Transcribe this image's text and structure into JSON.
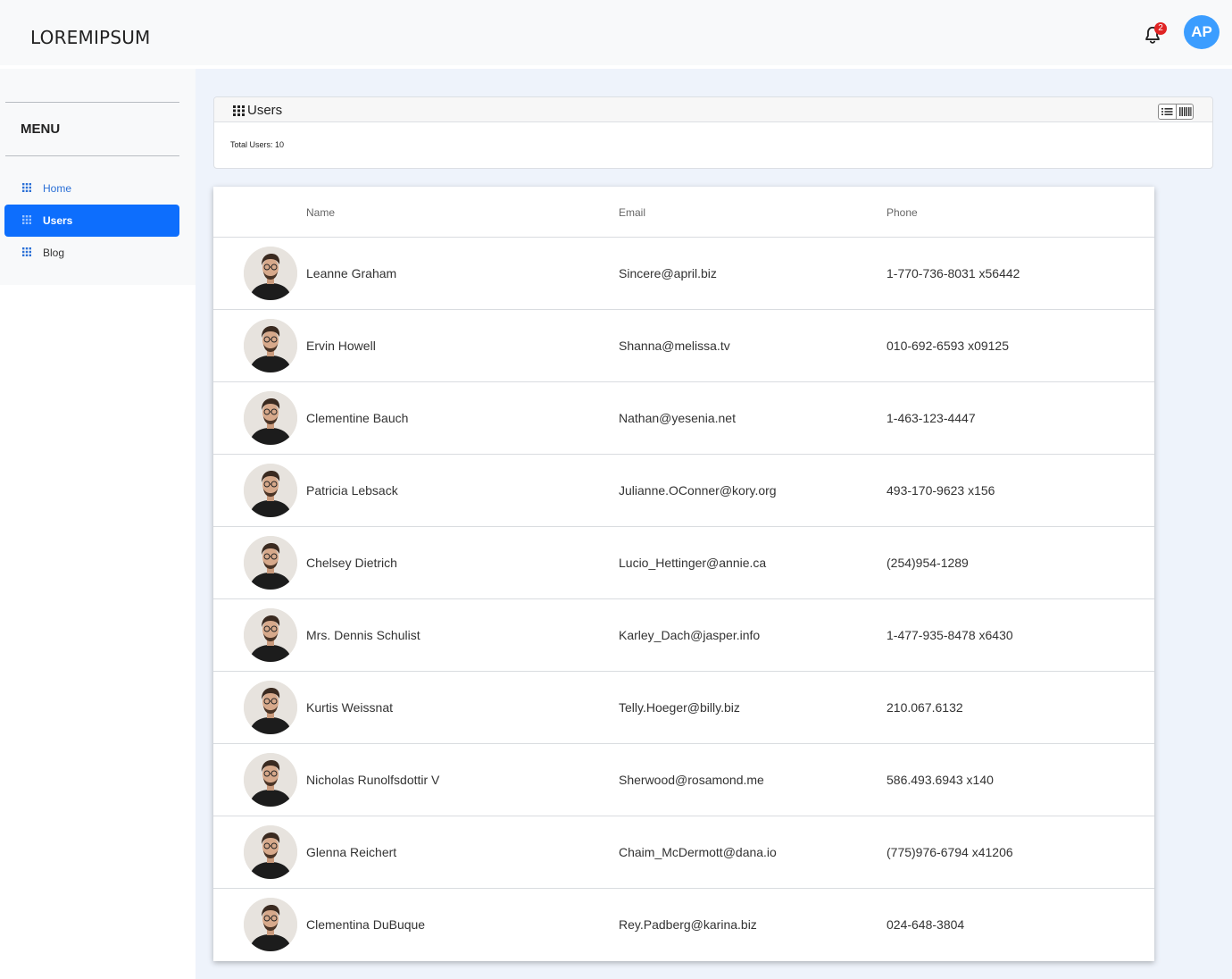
{
  "header": {
    "brand": "LOREMIPSUM",
    "notification_count": "2",
    "user_initials": "AP"
  },
  "sidebar": {
    "menu_title": "MENU",
    "items": [
      {
        "label": "Home",
        "icon": "grid-icon"
      },
      {
        "label": "Users",
        "icon": "grid-icon",
        "active": true
      },
      {
        "label": "Blog",
        "icon": "grid-icon"
      }
    ]
  },
  "users_card": {
    "title": "Users",
    "total_label": "Total Users: 10"
  },
  "table": {
    "columns": [
      "Name",
      "Email",
      "Phone"
    ],
    "rows": [
      {
        "name": "Leanne Graham",
        "email": "Sincere@april.biz",
        "phone": "1-770-736-8031 x56442"
      },
      {
        "name": "Ervin Howell",
        "email": "Shanna@melissa.tv",
        "phone": "010-692-6593 x09125"
      },
      {
        "name": "Clementine Bauch",
        "email": "Nathan@yesenia.net",
        "phone": "1-463-123-4447"
      },
      {
        "name": "Patricia Lebsack",
        "email": "Julianne.OConner@kory.org",
        "phone": "493-170-9623 x156"
      },
      {
        "name": "Chelsey Dietrich",
        "email": "Lucio_Hettinger@annie.ca",
        "phone": "(254)954-1289"
      },
      {
        "name": "Mrs. Dennis Schulist",
        "email": "Karley_Dach@jasper.info",
        "phone": "1-477-935-8478 x6430"
      },
      {
        "name": "Kurtis Weissnat",
        "email": "Telly.Hoeger@billy.biz",
        "phone": "210.067.6132"
      },
      {
        "name": "Nicholas Runolfsdottir V",
        "email": "Sherwood@rosamond.me",
        "phone": "586.493.6943 x140"
      },
      {
        "name": "Glenna Reichert",
        "email": "Chaim_McDermott@dana.io",
        "phone": "(775)976-6794 x41206"
      },
      {
        "name": "Clementina DuBuque",
        "email": "Rey.Padberg@karina.biz",
        "phone": "024-648-3804"
      }
    ]
  },
  "colors": {
    "accent": "#0d6efd",
    "avatar_bg": "#3b9dff",
    "badge": "#e02424",
    "main_bg": "#eef3fb"
  }
}
